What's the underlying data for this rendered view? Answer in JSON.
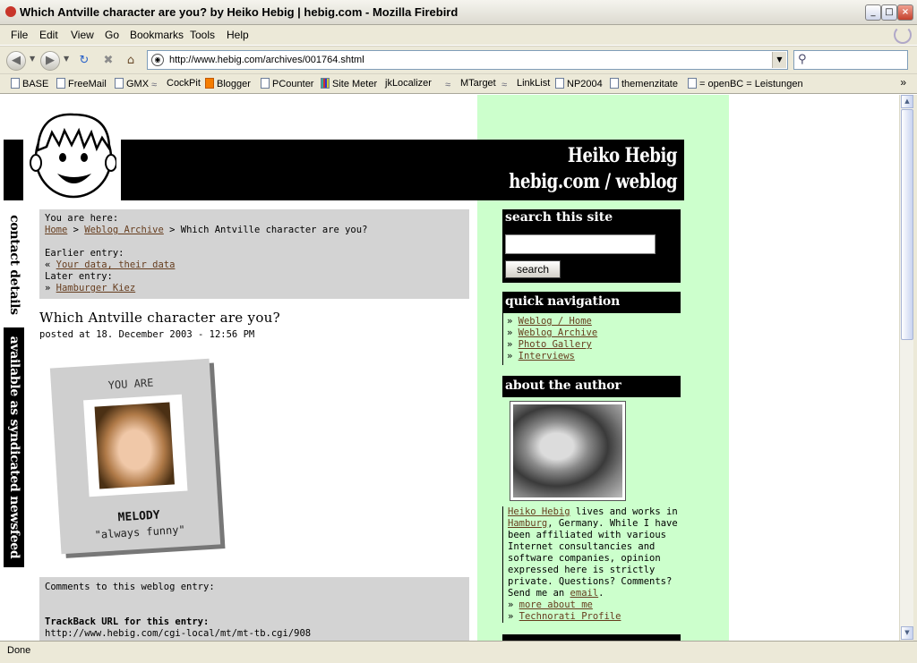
{
  "window": {
    "title": "Which Antville character are you? by Heiko Hebig  |  hebig.com - Mozilla Firebird"
  },
  "menu": [
    "File",
    "Edit",
    "View",
    "Go",
    "Bookmarks",
    "Tools",
    "Help"
  ],
  "address": {
    "url": "http://www.hebig.com/archives/001764.shtml"
  },
  "bookmarks": [
    "BASE",
    "FreeMail",
    "GMX",
    "CockPit",
    "Blogger",
    "PCounter",
    "Site Meter",
    "jkLocalizer",
    "MTarget",
    "LinkList",
    "NP2004",
    "themenzitate",
    "= openBC = Leistungen"
  ],
  "status": {
    "text": "Done"
  },
  "page": {
    "header": {
      "name": "Heiko Hebig",
      "site": "hebig.com / weblog"
    },
    "side_tabs": {
      "contact": "contact details",
      "feed": "available as syndicated newsfeed"
    },
    "crumbs": {
      "you_are_here": "You are here:",
      "home": "Home",
      "sep": ">",
      "archive": "Weblog Archive",
      "current": "Which Antville character are you?",
      "earlier_label": "Earlier entry:",
      "earlier_link": "Your data, their data",
      "later_label": "Later entry:",
      "later_link": "Hamburger Kiez",
      "left_marker": "«",
      "right_marker": "»"
    },
    "post": {
      "title": "Which Antville character are you?",
      "date": "posted at 18. December 2003 - 12:56 PM"
    },
    "card": {
      "you_are": "YOU ARE",
      "name": "MELODY",
      "tagline": "\"always funny\""
    },
    "comments": {
      "label": "Comments to this weblog entry:",
      "trackback_label": "TrackBack URL for this entry:",
      "trackback_url": "http://www.hebig.com/cgi-local/mt/mt-tb.cgi/908"
    },
    "sidebar": {
      "search_title": "search this site",
      "search_button": "search",
      "quicknav_title": "quick navigation",
      "quicknav": [
        "Weblog / Home",
        "Weblog Archive",
        "Photo Gallery",
        "Interviews"
      ],
      "author_title": "about the author",
      "author": {
        "name_link": "Heiko Hebig",
        "lives": " lives and works in",
        "city_link": "Hamburg",
        "country": ", Germany.",
        "bio": "While I have been affiliated with various Internet consultancies and software companies, opinion expressed here is strictly private. Questions? Comments? Send me an ",
        "email_link": "email",
        "period": ".",
        "more_link": "more about me",
        "technorati_link": "Technorati Profile"
      }
    }
  }
}
